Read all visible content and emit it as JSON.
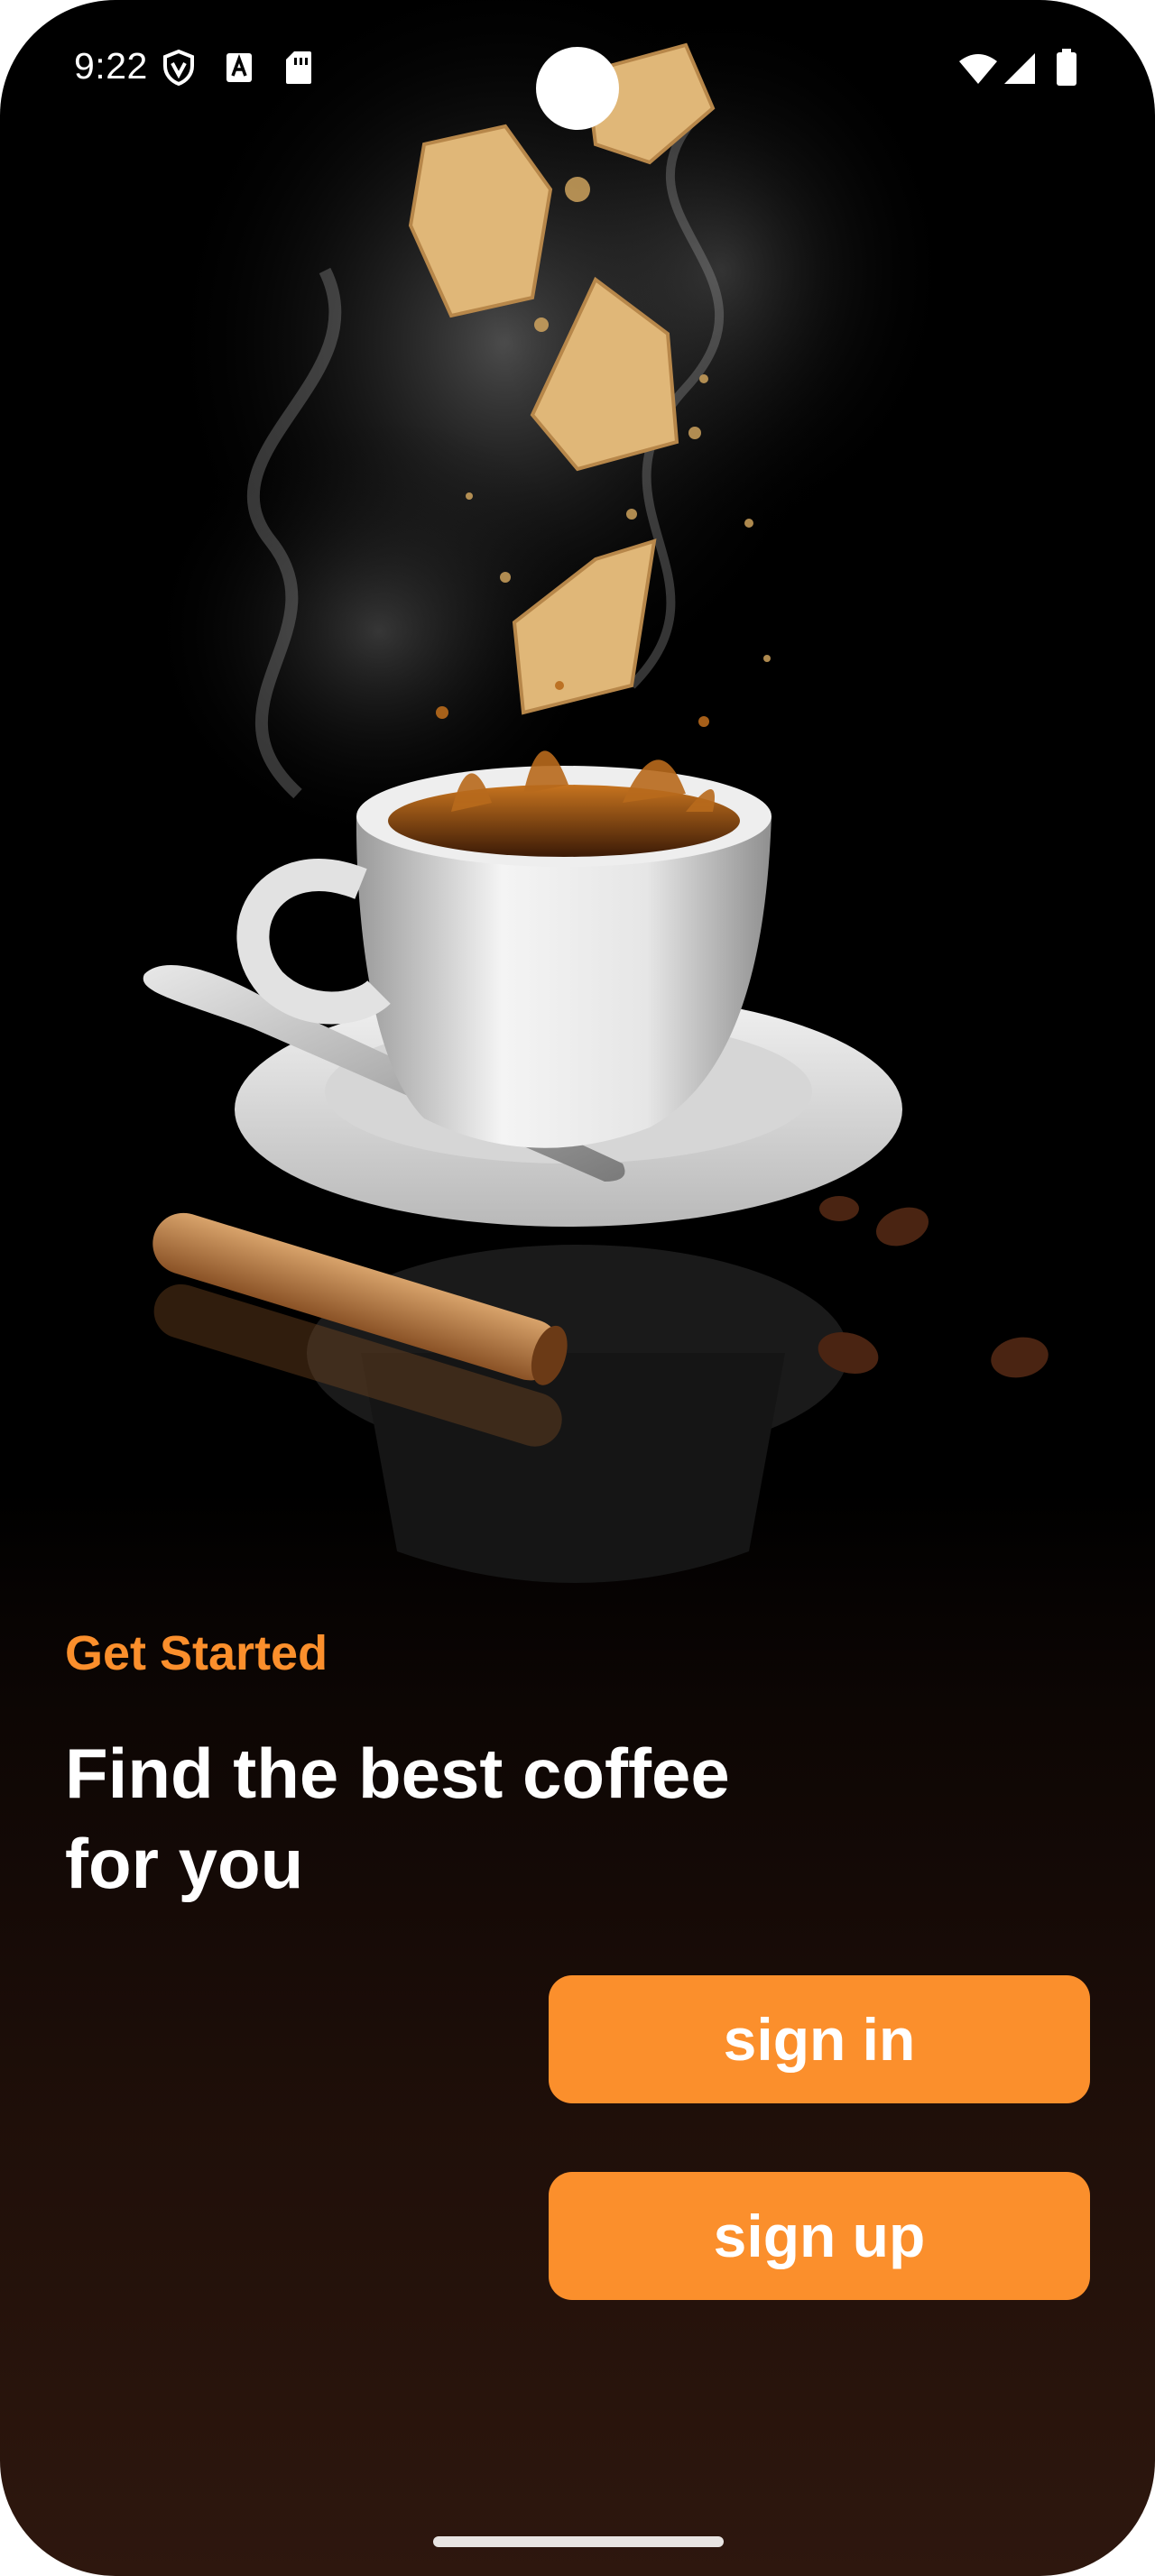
{
  "status_bar": {
    "time": "9:22",
    "icons": [
      "vpn-shield-icon",
      "keyboard-a-icon",
      "sim-card-icon",
      "wifi-icon",
      "cellular-signal-icon",
      "battery-icon"
    ]
  },
  "hero": {
    "image": "coffee-cup-with-falling-cookies"
  },
  "onboarding": {
    "eyebrow": "Get Started",
    "headline_line1": "Find the best coffee",
    "headline_line2": "for you"
  },
  "buttons": {
    "sign_in": "sign in",
    "sign_up": "sign up"
  },
  "colors": {
    "accent": "#fb8f2c",
    "background_top": "#000000",
    "background_bottom": "#2e170e",
    "text_primary": "#ffffff"
  }
}
